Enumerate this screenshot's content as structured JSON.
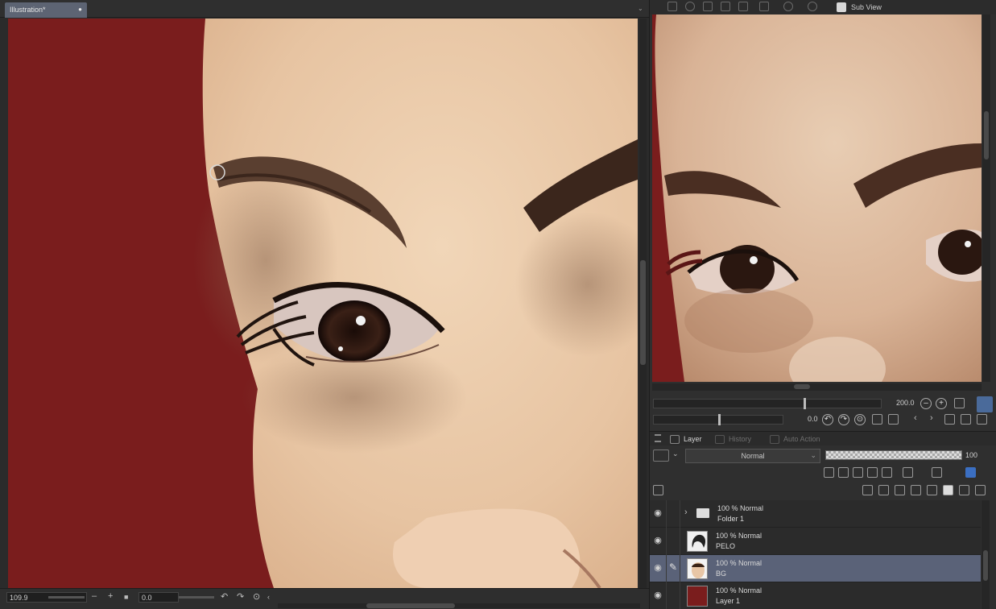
{
  "document": {
    "tab_title": "Illustration*",
    "tab_close": "●"
  },
  "status": {
    "zoom": "109.9",
    "minus": "–",
    "plus": "+",
    "rotation": "0.0"
  },
  "subview": {
    "tab_label": "Sub View",
    "zoom": "200.0",
    "rotation": "0.0"
  },
  "layer_panel": {
    "tabs": [
      {
        "label": "Layer",
        "active": true
      },
      {
        "label": "History",
        "active": false
      },
      {
        "label": "Auto Action",
        "active": false
      }
    ],
    "blend_mode": "Normal",
    "opacity": "100",
    "layers": [
      {
        "mode": "100 % Normal",
        "name": "Folder 1",
        "type": "folder",
        "visible": true,
        "selected": false
      },
      {
        "mode": "100 % Normal",
        "name": "PELO",
        "type": "raster",
        "visible": true,
        "selected": false
      },
      {
        "mode": "100 % Normal",
        "name": "BG",
        "type": "raster",
        "visible": true,
        "selected": true
      },
      {
        "mode": "100 % Normal",
        "name": "Layer 1",
        "type": "raster",
        "visible": true,
        "selected": false
      }
    ]
  },
  "icons": {
    "eye": "eye-icon",
    "pen": "pen-icon",
    "folder": "folder-icon"
  },
  "colors": {
    "canvas_background": "#7a1d1d",
    "skin": "#eccbaa",
    "selected_layer": "#5a6278",
    "tab_active": "#5d6473"
  }
}
